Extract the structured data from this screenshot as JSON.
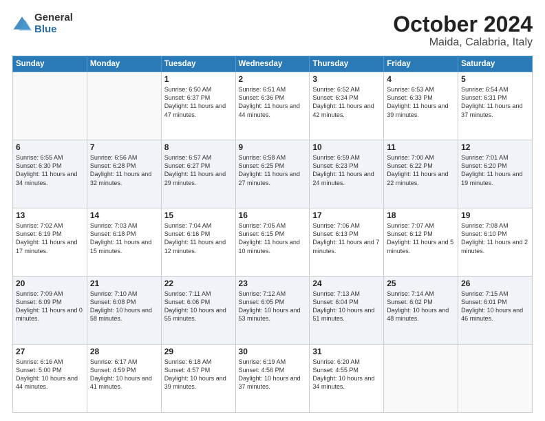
{
  "logo": {
    "general": "General",
    "blue": "Blue"
  },
  "title": {
    "month": "October 2024",
    "location": "Maida, Calabria, Italy"
  },
  "weekdays": [
    "Sunday",
    "Monday",
    "Tuesday",
    "Wednesday",
    "Thursday",
    "Friday",
    "Saturday"
  ],
  "weeks": [
    [
      {
        "day": "",
        "detail": ""
      },
      {
        "day": "",
        "detail": ""
      },
      {
        "day": "1",
        "detail": "Sunrise: 6:50 AM\nSunset: 6:37 PM\nDaylight: 11 hours\nand 47 minutes."
      },
      {
        "day": "2",
        "detail": "Sunrise: 6:51 AM\nSunset: 6:36 PM\nDaylight: 11 hours\nand 44 minutes."
      },
      {
        "day": "3",
        "detail": "Sunrise: 6:52 AM\nSunset: 6:34 PM\nDaylight: 11 hours\nand 42 minutes."
      },
      {
        "day": "4",
        "detail": "Sunrise: 6:53 AM\nSunset: 6:33 PM\nDaylight: 11 hours\nand 39 minutes."
      },
      {
        "day": "5",
        "detail": "Sunrise: 6:54 AM\nSunset: 6:31 PM\nDaylight: 11 hours\nand 37 minutes."
      }
    ],
    [
      {
        "day": "6",
        "detail": "Sunrise: 6:55 AM\nSunset: 6:30 PM\nDaylight: 11 hours\nand 34 minutes."
      },
      {
        "day": "7",
        "detail": "Sunrise: 6:56 AM\nSunset: 6:28 PM\nDaylight: 11 hours\nand 32 minutes."
      },
      {
        "day": "8",
        "detail": "Sunrise: 6:57 AM\nSunset: 6:27 PM\nDaylight: 11 hours\nand 29 minutes."
      },
      {
        "day": "9",
        "detail": "Sunrise: 6:58 AM\nSunset: 6:25 PM\nDaylight: 11 hours\nand 27 minutes."
      },
      {
        "day": "10",
        "detail": "Sunrise: 6:59 AM\nSunset: 6:23 PM\nDaylight: 11 hours\nand 24 minutes."
      },
      {
        "day": "11",
        "detail": "Sunrise: 7:00 AM\nSunset: 6:22 PM\nDaylight: 11 hours\nand 22 minutes."
      },
      {
        "day": "12",
        "detail": "Sunrise: 7:01 AM\nSunset: 6:20 PM\nDaylight: 11 hours\nand 19 minutes."
      }
    ],
    [
      {
        "day": "13",
        "detail": "Sunrise: 7:02 AM\nSunset: 6:19 PM\nDaylight: 11 hours\nand 17 minutes."
      },
      {
        "day": "14",
        "detail": "Sunrise: 7:03 AM\nSunset: 6:18 PM\nDaylight: 11 hours\nand 15 minutes."
      },
      {
        "day": "15",
        "detail": "Sunrise: 7:04 AM\nSunset: 6:16 PM\nDaylight: 11 hours\nand 12 minutes."
      },
      {
        "day": "16",
        "detail": "Sunrise: 7:05 AM\nSunset: 6:15 PM\nDaylight: 11 hours\nand 10 minutes."
      },
      {
        "day": "17",
        "detail": "Sunrise: 7:06 AM\nSunset: 6:13 PM\nDaylight: 11 hours\nand 7 minutes."
      },
      {
        "day": "18",
        "detail": "Sunrise: 7:07 AM\nSunset: 6:12 PM\nDaylight: 11 hours\nand 5 minutes."
      },
      {
        "day": "19",
        "detail": "Sunrise: 7:08 AM\nSunset: 6:10 PM\nDaylight: 11 hours\nand 2 minutes."
      }
    ],
    [
      {
        "day": "20",
        "detail": "Sunrise: 7:09 AM\nSunset: 6:09 PM\nDaylight: 11 hours\nand 0 minutes."
      },
      {
        "day": "21",
        "detail": "Sunrise: 7:10 AM\nSunset: 6:08 PM\nDaylight: 10 hours\nand 58 minutes."
      },
      {
        "day": "22",
        "detail": "Sunrise: 7:11 AM\nSunset: 6:06 PM\nDaylight: 10 hours\nand 55 minutes."
      },
      {
        "day": "23",
        "detail": "Sunrise: 7:12 AM\nSunset: 6:05 PM\nDaylight: 10 hours\nand 53 minutes."
      },
      {
        "day": "24",
        "detail": "Sunrise: 7:13 AM\nSunset: 6:04 PM\nDaylight: 10 hours\nand 51 minutes."
      },
      {
        "day": "25",
        "detail": "Sunrise: 7:14 AM\nSunset: 6:02 PM\nDaylight: 10 hours\nand 48 minutes."
      },
      {
        "day": "26",
        "detail": "Sunrise: 7:15 AM\nSunset: 6:01 PM\nDaylight: 10 hours\nand 46 minutes."
      }
    ],
    [
      {
        "day": "27",
        "detail": "Sunrise: 6:16 AM\nSunset: 5:00 PM\nDaylight: 10 hours\nand 44 minutes."
      },
      {
        "day": "28",
        "detail": "Sunrise: 6:17 AM\nSunset: 4:59 PM\nDaylight: 10 hours\nand 41 minutes."
      },
      {
        "day": "29",
        "detail": "Sunrise: 6:18 AM\nSunset: 4:57 PM\nDaylight: 10 hours\nand 39 minutes."
      },
      {
        "day": "30",
        "detail": "Sunrise: 6:19 AM\nSunset: 4:56 PM\nDaylight: 10 hours\nand 37 minutes."
      },
      {
        "day": "31",
        "detail": "Sunrise: 6:20 AM\nSunset: 4:55 PM\nDaylight: 10 hours\nand 34 minutes."
      },
      {
        "day": "",
        "detail": ""
      },
      {
        "day": "",
        "detail": ""
      }
    ]
  ]
}
